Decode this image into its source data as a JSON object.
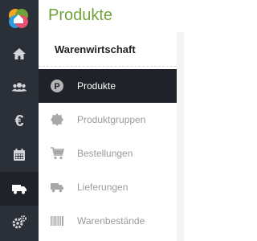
{
  "app": {
    "logo_colors": [
      "#f5a623",
      "#6fa33a",
      "#2d9be0",
      "#e94f6e"
    ],
    "accent_color": "#6fa33a"
  },
  "header": {
    "title": "Produkte"
  },
  "rail": {
    "items": [
      {
        "icon": "home-icon"
      },
      {
        "icon": "users-icon"
      },
      {
        "icon": "euro-icon",
        "glyph": "€"
      },
      {
        "icon": "calendar-icon"
      },
      {
        "icon": "truck-icon",
        "active": true
      },
      {
        "icon": "gears-icon"
      }
    ]
  },
  "submenu": {
    "title": "Warenwirtschaft",
    "items": [
      {
        "label": "Produkte",
        "icon": "product-p-icon",
        "active": true
      },
      {
        "label": "Produktgruppen",
        "icon": "badge-icon"
      },
      {
        "label": "Bestellungen",
        "icon": "cart-icon"
      },
      {
        "label": "Lieferungen",
        "icon": "truck-icon"
      },
      {
        "label": "Warenbestände",
        "icon": "barcode-icon"
      }
    ]
  }
}
